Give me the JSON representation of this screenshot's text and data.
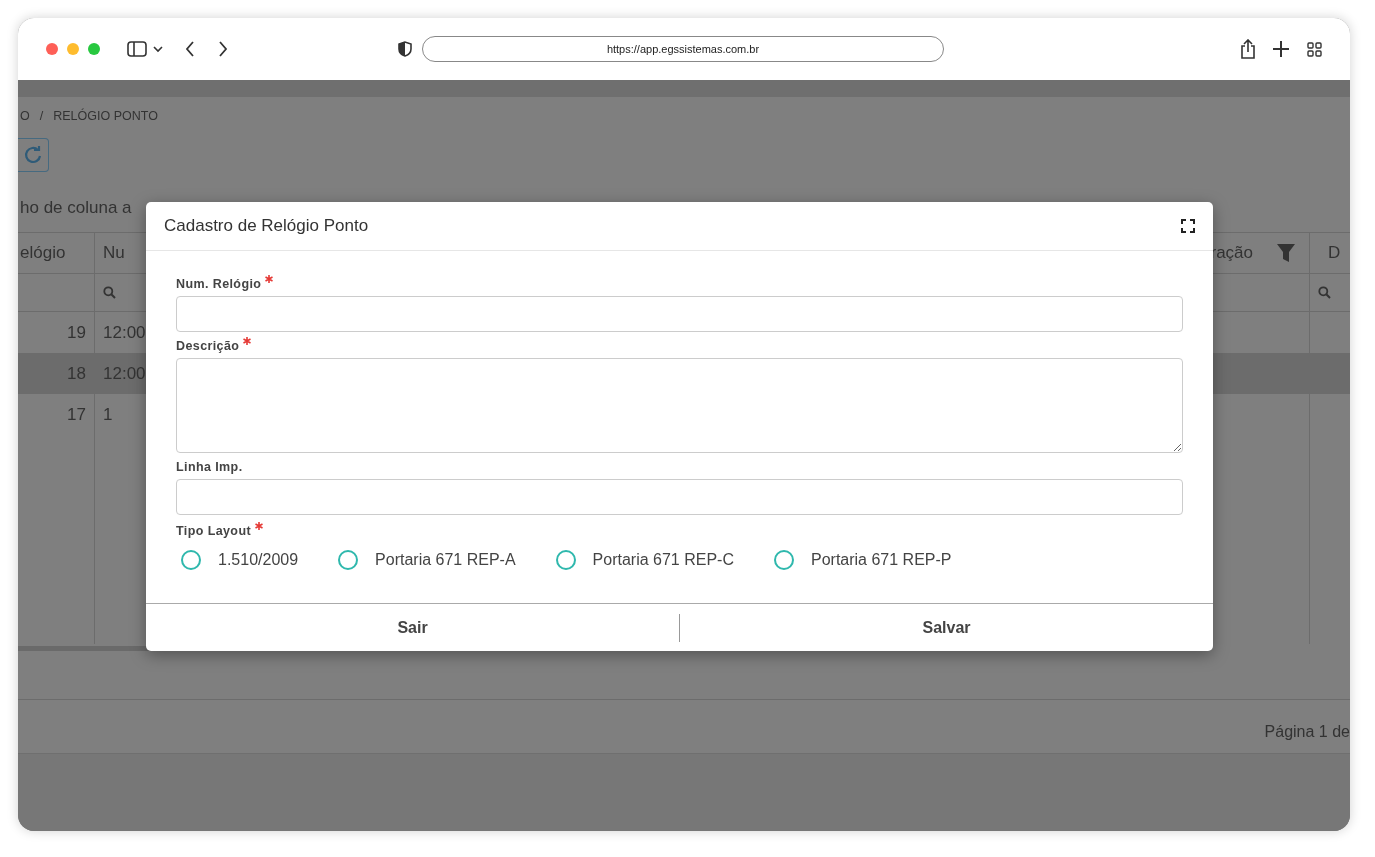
{
  "browser": {
    "url": "https://app.egssistemas.com.br"
  },
  "page": {
    "breadcrumb": [
      "O",
      "RELÓGIO PONTO"
    ],
    "breadcrumb_separator": "/",
    "grouping_hint": "ho de coluna a",
    "table": {
      "columns": [
        {
          "label": "elógio",
          "filter": false
        },
        {
          "label": "Nu",
          "filter": false
        },
        {
          "label": "ração",
          "filter": true
        },
        {
          "label": "D",
          "filter": false
        }
      ],
      "rows": [
        {
          "column_1": "19",
          "column_2": "12:00",
          "selected": false
        },
        {
          "column_1": "18",
          "column_2": "12:00",
          "selected": true
        },
        {
          "column_1": "17",
          "column_2": "1",
          "selected": false
        }
      ]
    },
    "pager": "Página 1 de"
  },
  "dialog": {
    "title": "Cadastro de Relógio Ponto",
    "fields": [
      {
        "label": "Num. Relógio",
        "required": true,
        "kind": "input"
      },
      {
        "label": "Descrição",
        "required": true,
        "kind": "textarea"
      },
      {
        "label": "Linha Imp.",
        "required": false,
        "kind": "input"
      }
    ],
    "radio_group": {
      "label": "Tipo Layout",
      "required": true,
      "options": [
        {
          "label": "1.510/2009",
          "selected": false
        },
        {
          "label": "Portaria 671 REP-A",
          "selected": false
        },
        {
          "label": "Portaria 671 REP-C",
          "selected": false
        },
        {
          "label": "Portaria 671 REP-P",
          "selected": false
        }
      ]
    },
    "buttons": [
      "Sair",
      "Salvar"
    ]
  }
}
